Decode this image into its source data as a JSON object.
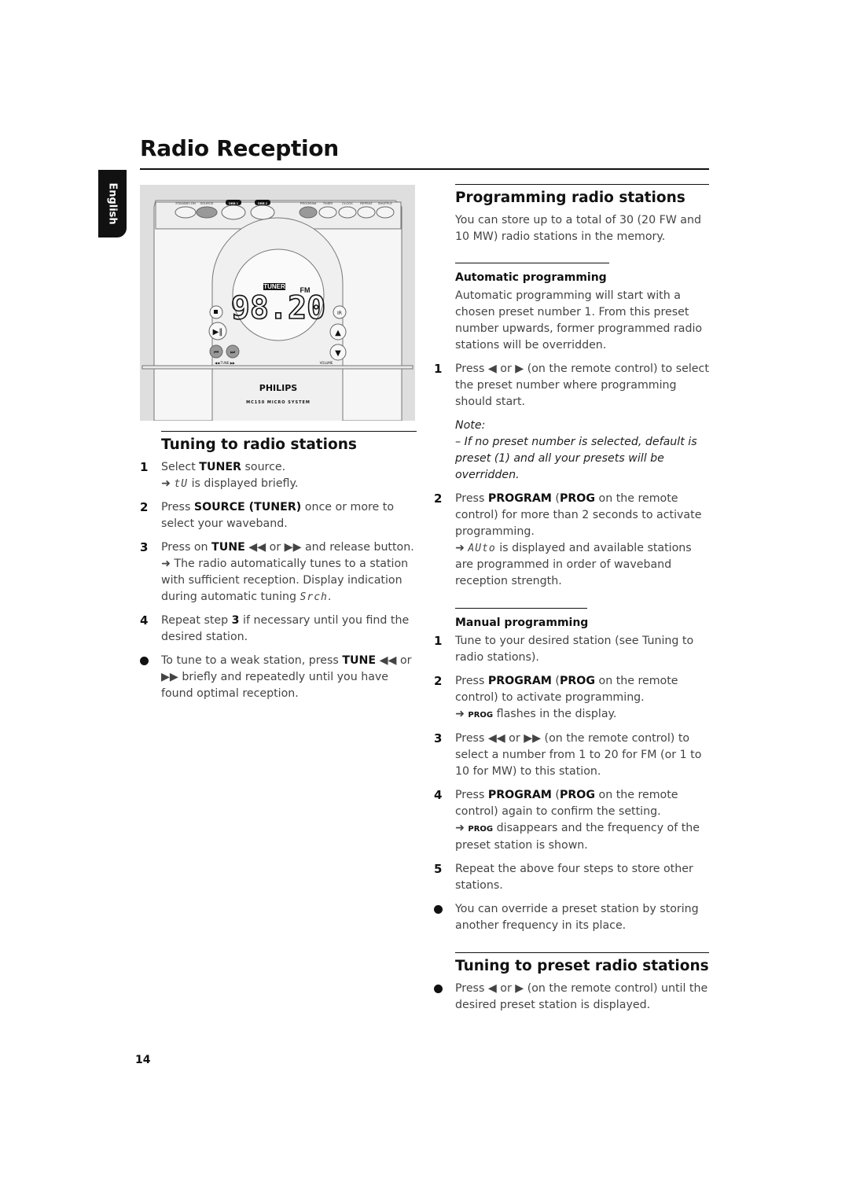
{
  "page": {
    "title": "Radio Reception",
    "language_tab": "English",
    "page_number": "14"
  },
  "illustration": {
    "buttons_top": [
      "STANDBY-ON",
      "SOURCE",
      "DBB 1",
      "DBB 2",
      "PROGRAM",
      "TIMER",
      "CLOCK",
      "REPEAT",
      "SHUFFLE"
    ],
    "display_source": "TUNER",
    "display_band": "FM",
    "display_frequency": "98.20",
    "tune_label": "◀◀ TUNE ▶▶",
    "volume_label": "VOLUME",
    "brand": "PHILIPS",
    "model": "MC150 MICRO SYSTEM",
    "ir_label": "IR"
  },
  "tuning": {
    "title": "Tuning to radio stations",
    "steps": [
      {
        "num": "1",
        "pre": "Select ",
        "bold": "TUNER",
        "post": " source.",
        "result_lcd": "tU",
        "result_text": " is displayed briefly."
      },
      {
        "num": "2",
        "pre": "Press ",
        "bold": "SOURCE (TUNER)",
        "post": " once or more to select your waveband."
      },
      {
        "num": "3",
        "pre": "Press on ",
        "bold": "TUNE",
        "mid": " ◀◀ or ▶▶ and release button.",
        "result_text": " The radio automatically tunes to a station with sufficient reception. Display indication during automatic tuning ",
        "result_lcd": "Srch",
        "result_end": "."
      },
      {
        "num": "4",
        "pre": "Repeat step ",
        "bold": "3",
        "post": " if necessary until you find the desired station."
      }
    ],
    "bullet": {
      "pre": "To tune to a weak station, press ",
      "bold": "TUNE",
      "post": " ◀◀ or ▶▶ briefly and repeatedly until you have found optimal reception."
    }
  },
  "programming": {
    "title": "Programming radio stations",
    "intro": "You can store up to a total of 30 (20 FW and 10 MW) radio stations in the memory.",
    "automatic": {
      "title": "Automatic programming",
      "intro": "Automatic programming will start with a chosen preset number 1. From this preset number upwards, former programmed radio stations will be overridden.",
      "step1": {
        "num": "1",
        "text": "Press ◀ or ▶ (on the remote control) to select the preset number where programming should start."
      },
      "note_label": "Note:",
      "note_text": "–  If no preset number is selected, default is preset (1) and all your presets will be overridden.",
      "step2": {
        "num": "2",
        "pre": "Press ",
        "bold1": "PROGRAM",
        "mid": " (",
        "bold2": "PROG",
        "post": " on the remote control) for more than 2 seconds to activate programming.",
        "result_lcd": "AUto",
        "result_text": " is displayed and available stations are programmed in order of waveband reception strength."
      }
    },
    "manual": {
      "title": "Manual programming",
      "steps": [
        {
          "num": "1",
          "text": "Tune to your desired station (see Tuning to radio stations)."
        },
        {
          "num": "2",
          "pre": "Press ",
          "bold1": "PROGRAM",
          "mid": " (",
          "bold2": "PROG",
          "post": " on the remote control) to activate programming.",
          "result_caps": "PROG",
          "result_text": " flashes in the display."
        },
        {
          "num": "3",
          "text": "Press  ◀◀ or ▶▶ (on the remote control) to select a number from 1 to 20 for FM (or 1 to 10 for MW) to this station."
        },
        {
          "num": "4",
          "pre": "Press ",
          "bold1": "PROGRAM",
          "mid": " (",
          "bold2": "PROG",
          "post": " on the remote control) again to confirm the setting.",
          "result_caps": "PROG",
          "result_text": " disappears and the frequency of the preset station is shown."
        },
        {
          "num": "5",
          "text": "Repeat the above four steps to store other stations."
        }
      ],
      "bullet": "You can override a preset station by storing another frequency in its place."
    }
  },
  "preset": {
    "title": "Tuning to preset radio stations",
    "bullet": "Press ◀ or ▶ (on the remote control) until the desired preset station is displayed."
  },
  "arrow": "➜"
}
